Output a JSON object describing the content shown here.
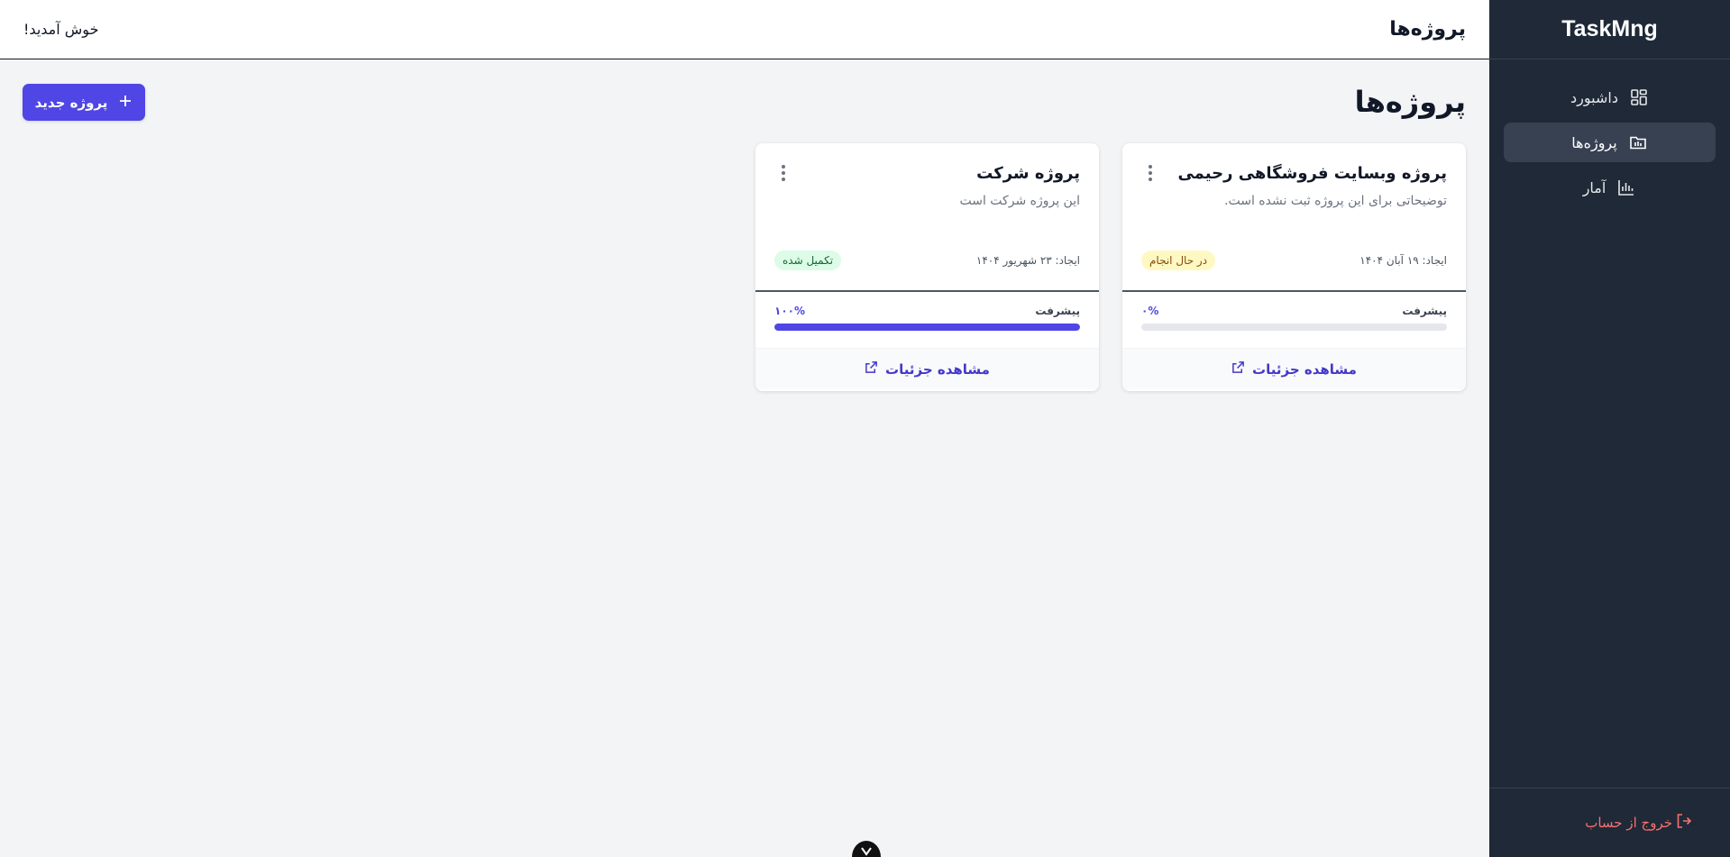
{
  "app": {
    "brand": "TaskMng"
  },
  "sidebar": {
    "items": [
      {
        "label": "داشبورد",
        "icon": "dashboard-icon"
      },
      {
        "label": "پروژه‌ها",
        "icon": "folder-icon"
      },
      {
        "label": "آمار",
        "icon": "chart-icon"
      }
    ],
    "logout_label": "خروج از حساب"
  },
  "header": {
    "title": "پروژه‌ها",
    "welcome": "خوش آمدید!"
  },
  "main": {
    "title": "پروژه‌ها",
    "new_project_label": "پروژه جدید",
    "projects": [
      {
        "title": "پروژه وبسایت فروشگاهی رحیمی",
        "description": "توضیحاتی برای این پروژه ثبت نشده است.",
        "created": "ایجاد: ۱۹ آبان ۱۴۰۴",
        "status": "در حال انجام",
        "status_color": "#fef9c3",
        "status_text_color": "#854d0e",
        "progress_label": "پیشرفت",
        "progress_text": "۰%",
        "progress": 0,
        "details_label": "مشاهده جزئیات"
      },
      {
        "title": "پروژه شرکت",
        "description": "این پروژه شرکت است",
        "created": "ایجاد: ۲۳ شهریور ۱۴۰۴",
        "status": "تکمیل شده",
        "status_color": "#dcfce7",
        "status_text_color": "#166534",
        "progress_label": "پیشرفت",
        "progress_text": "۱۰۰%",
        "progress": 100,
        "details_label": "مشاهده جزئیات"
      }
    ]
  },
  "colors": {
    "accent": "#4f46e5",
    "sidebar_bg": "#1f2937",
    "logout": "#f87171"
  }
}
